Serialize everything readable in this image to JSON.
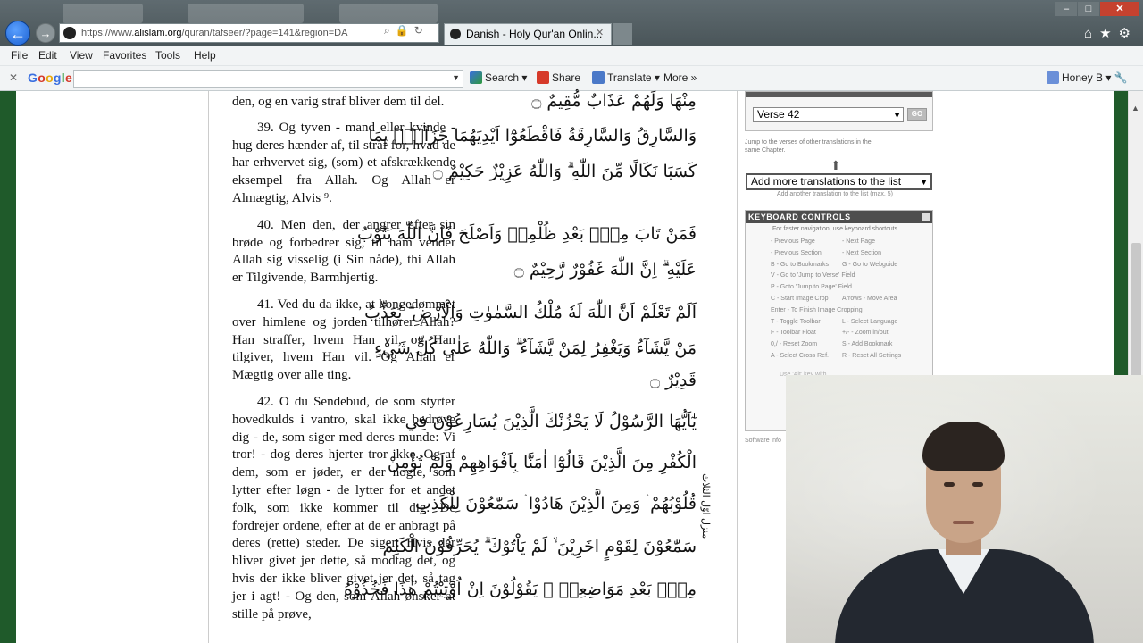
{
  "browser": {
    "url_prefix": "https://www.",
    "url_host": "alislam.org",
    "url_rest": "/quran/tafseer/?page=141&region=DA",
    "tab_title": "Danish - Holy Qur'an Onlin...",
    "window_controls": {
      "minimize": "–",
      "maximize": "□",
      "close": "✕"
    }
  },
  "menu": [
    "File",
    "Edit",
    "View",
    "Favorites",
    "Tools",
    "Help"
  ],
  "google_toolbar": {
    "logo": "Google",
    "search_label": "Search",
    "share_label": "Share",
    "translate_label": "Translate",
    "more_label": "More",
    "user_label": "Honey B"
  },
  "quran_page": {
    "danish_verses": [
      "den, og en varig straf bliver dem til del.",
      "39. Og tyven - mand eller kvinde - hug deres hænder af, til straf for, hvad de har erhvervet sig, (som) et afskrækkende eksempel fra Allah. Og Allah er Almægtig, Alvis ⁹.",
      "40. Men den, der angrer efter sin brøde og forbedrer sig, til ham vender Allah sig visselig (i Sin nåde), thi Allah er Tilgivende, Barmhjertig.",
      "41. Ved du da ikke, at kongedømmet over himlene og jorden tilhører Allah? Han straffer, hvem Han vil, og Han tilgiver, hvem Han vil. Og Allah er Mægtig over alle ting.",
      "42. O du Sendebud, de som styrter hovedkulds i vantro, skal ikke bedrøve dig - de, som siger med deres munde: Vi tror! - dog deres hjerter tror ikke. Og af dem, som er jøder, er der nogle, som lytter efter løgn - de lytter for et andet folk, som ikke kommer til dig. De fordrejer ordene, efter at de er anbragt på deres (rette) steder. De siger: Hvis der bliver givet jer dette, så modtag det, og hvis der ikke bliver givet jer det, så tag jer i agt! - Og den, som Allah ønsker at stille på prøve,"
    ],
    "arabic_lines": [
      "مِنْهَا وَلَهُمْ عَذَابٌ مُّقِيمٌ ۝",
      "وَالسَّارِقُ وَالسَّارِقَةُ فَاقْطَعُوْٓا اَيْدِيَهُمَا جَزَآءًۢ بِمَا",
      "كَسَبَا نَكَالًا مِّنَ اللّٰهِ ۗ وَاللّٰهُ عَزِيْزٌ حَكِيْمٌ ۝",
      "فَمَنْ تَابَ مِنْۢ بَعْدِ ظُلْمِهٖ وَاَصْلَحَ فَاِنَّ اللّٰهَ يَتُوْبُ",
      "عَلَيْهِ ۗ اِنَّ اللّٰهَ غَفُوْرٌ رَّحِيْمٌ ۝",
      "اَلَمْ تَعْلَمْ اَنَّ اللّٰهَ لَهٗ مُلْكُ السَّمٰوٰتِ وَالْاَرْضِ ۗ يُعَذِّبُ",
      "مَنْ يَّشَآءُ وَيَغْفِرُ لِمَنْ يَّشَآءُ ۗ وَاللّٰهُ عَلٰى كُلِّ شَيْءٍ",
      "قَدِيْرٌ ۝",
      "يٰٓاَيُّهَا الرَّسُوْلُ لَا يَحْزُنْكَ الَّذِيْنَ يُسَارِعُوْنَ فِي",
      "الْكُفْرِ مِنَ الَّذِيْنَ قَالُوْٓا اٰمَنَّا بِاَفْوَاهِهِمْ وَلَمْ تُؤْمِنْ",
      "قُلُوْبُهُمْ ۛ وَمِنَ الَّذِيْنَ هَادُوْا ۛ سَمّٰعُوْنَ لِلْكَذِبِ",
      "سَمّٰعُوْنَ لِقَوْمٍ اٰخَرِيْنَ ۙ لَمْ يَاْتُوْكَ ۗ يُحَرِّفُوْنَ الْكَلِمَ",
      "مِنْۢ بَعْدِ مَوَاضِعِهٖ ۚ يَقُوْلُوْنَ اِنْ اُوْتِيْتُمْ هٰذَا فَخُذُوْهُ"
    ],
    "margin_note": "منزل اوّل الثلاث"
  },
  "sidebar": {
    "verse_select": "Verse 42",
    "go_label": "GO",
    "jump_text": "Jump to the verses of other translations in the same Chapter.",
    "add_translations": "Add more translations to the list",
    "add_translations_hint": "Add another translation to the list (max. 5)",
    "keyboard_title": "KEYBOARD CONTROLS",
    "keyboard_intro": "For faster navigation, use keyboard shortcuts.",
    "shortcuts": [
      [
        "- Previous Page",
        "- Next Page"
      ],
      [
        "- Previous Section",
        "- Next Section"
      ],
      [
        "B - Go to Bookmarks",
        "G - Go to Webguide"
      ],
      [
        "V - Go to 'Jump to Verse' Field",
        ""
      ],
      [
        "P - Goto 'Jump to Page' Field",
        ""
      ],
      [
        "C - Start Image Crop",
        "Arrows - Move Area"
      ],
      [
        "Enter - To Finish Image Cropping",
        ""
      ],
      [
        "T - Toggle Toolbar",
        "L - Select Language"
      ],
      [
        "F - Toolbar Float",
        "+/- - Zoom in/out"
      ],
      [
        "0,/ - Reset Zoom",
        "S - Add Bookmark"
      ],
      [
        "A - Select Cross Ref.",
        "R - Reset All Settings"
      ]
    ],
    "keyboard_footer": "Use 'Alt' key with ...",
    "software_info": "Software info"
  }
}
